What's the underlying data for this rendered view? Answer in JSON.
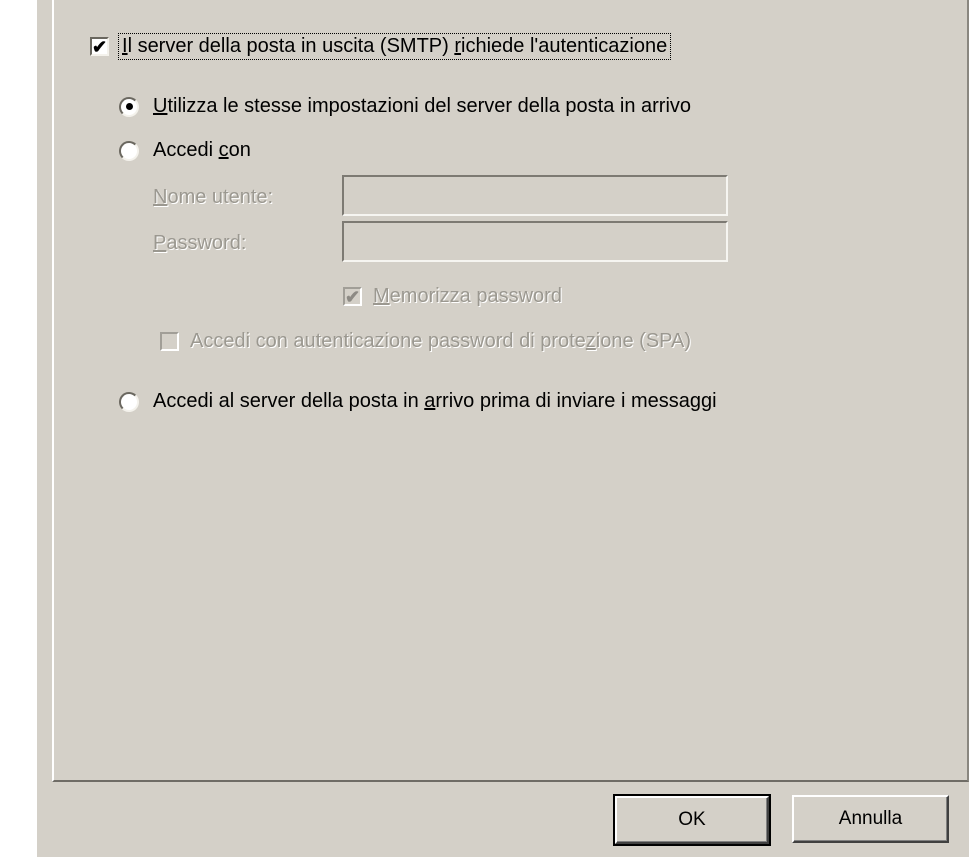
{
  "smtp_auth": {
    "checked": true,
    "label_pre": "",
    "label_mnemonic": "I",
    "label_post": "l server della posta in uscita (SMTP) ",
    "label_mnemonic2": "r",
    "label_end": "ichiede l'autenticazione"
  },
  "option_same_settings": {
    "selected": true,
    "mnemonic": "U",
    "rest": "tilizza le stesse impostazioni del server della posta in arrivo"
  },
  "option_login": {
    "selected": false,
    "pre": "Accedi ",
    "mnemonic": "c",
    "rest": "on"
  },
  "username": {
    "mnemonic": "N",
    "rest": "ome utente:",
    "value": ""
  },
  "password": {
    "mnemonic": "P",
    "rest": "assword:",
    "value": ""
  },
  "remember_password": {
    "checked": true,
    "mnemonic": "M",
    "rest": "emorizza password"
  },
  "spa": {
    "checked": false,
    "pre": "Accedi con autenticazione password di prote",
    "mnemonic": "z",
    "rest": "ione (SPA)"
  },
  "option_incoming_first": {
    "selected": false,
    "pre": "Accedi al server della posta in ",
    "mnemonic": "a",
    "rest": "rrivo prima di inviare i messaggi"
  },
  "buttons": {
    "ok": "OK",
    "cancel": "Annulla"
  }
}
